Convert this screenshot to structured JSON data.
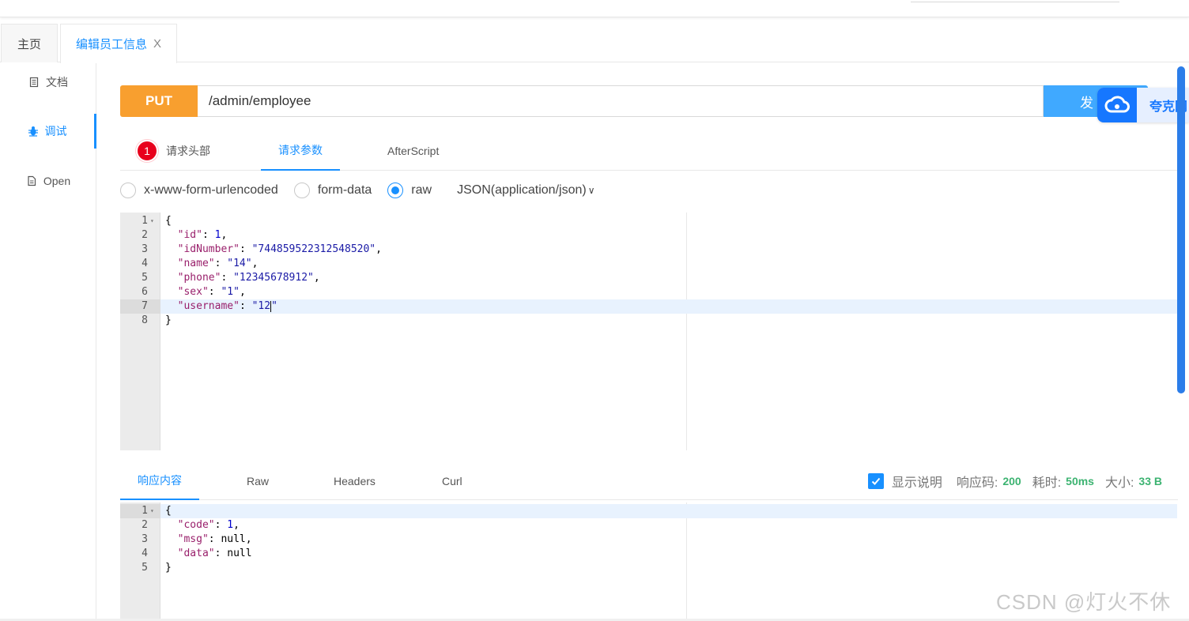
{
  "tabs": {
    "home": "主页",
    "edit": "编辑员工信息",
    "close_glyph": "X"
  },
  "sidebar": {
    "items": [
      {
        "label": "文档",
        "icon": "document-icon"
      },
      {
        "label": "调试",
        "icon": "bug-icon"
      },
      {
        "label": "Open",
        "icon": "file-icon"
      }
    ]
  },
  "request": {
    "method": "PUT",
    "url": "/admin/employee",
    "send_label": "发"
  },
  "overlay": {
    "quark_label": "夸克网"
  },
  "request_tabs": {
    "headers": "请求头部",
    "headers_badge": "1",
    "params": "请求参数",
    "after": "AfterScript"
  },
  "body_types": {
    "urlencoded": "x-www-form-urlencoded",
    "formdata": "form-data",
    "raw": "raw",
    "json": "JSON(application/json)",
    "selected": "raw"
  },
  "request_body": {
    "line_numbers": [
      "1",
      "2",
      "3",
      "4",
      "5",
      "6",
      "7",
      "8"
    ],
    "open": "{",
    "close": "}",
    "fields": [
      {
        "key": "\"id\"",
        "value": "1",
        "type": "number"
      },
      {
        "key": "\"idNumber\"",
        "value": "\"744859522312548520\"",
        "type": "string"
      },
      {
        "key": "\"name\"",
        "value": "\"14\"",
        "type": "string"
      },
      {
        "key": "\"phone\"",
        "value": "\"12345678912\"",
        "type": "string"
      },
      {
        "key": "\"sex\"",
        "value": "\"1\"",
        "type": "string"
      },
      {
        "key": "\"username\"",
        "value": "\"12\"",
        "type": "string"
      }
    ]
  },
  "response_tabs": {
    "content": "响应内容",
    "raw": "Raw",
    "headers": "Headers",
    "curl": "Curl"
  },
  "response_meta": {
    "show_desc": "显示说明",
    "code_label": "响应码:",
    "code": "200",
    "time_label": "耗时:",
    "time": "50ms",
    "size_label": "大小:",
    "size": "33 B"
  },
  "response_body": {
    "line_numbers": [
      "1",
      "2",
      "3",
      "4",
      "5"
    ],
    "open": "{",
    "close": "}",
    "fields": [
      {
        "key": "\"code\"",
        "value": "1",
        "type": "number"
      },
      {
        "key": "\"msg\"",
        "value": "null",
        "type": "null"
      },
      {
        "key": "\"data\"",
        "value": "null",
        "type": "null"
      }
    ]
  },
  "watermark": "CSDN @灯火不休",
  "colors": {
    "accent": "#1890ff",
    "method": "#f89f2f",
    "success": "#3cb371",
    "badge": "#e8001c"
  }
}
